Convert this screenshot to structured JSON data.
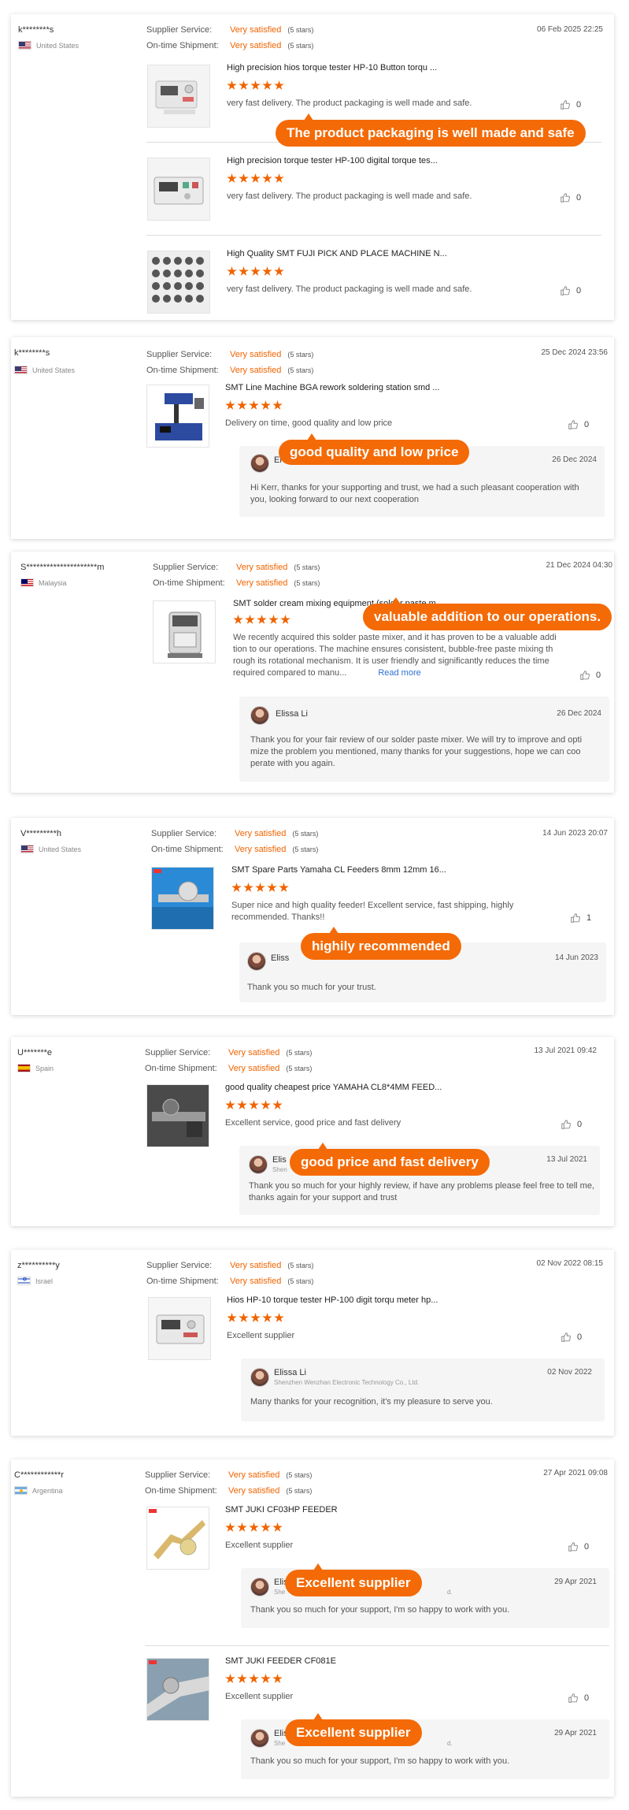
{
  "labels": {
    "supplier_service": "Supplier Service:",
    "ontime_shipment": "On-time Shipment:",
    "satisfied": "Very satisfied",
    "five_stars": "(5 stars)"
  },
  "colors": {
    "accent": "#f06400",
    "callout": "#f46a06",
    "link": "#2f6fd6"
  },
  "reviews": [
    {
      "buyer": "k********s",
      "country": "United States",
      "date": "06 Feb 2025 22:25",
      "products": [
        {
          "title": "High precision hios torque tester HP-10 Button torqu ...",
          "rating": 5,
          "text": "very fast delivery. The product packaging is well made and safe.",
          "likes": "0"
        },
        {
          "title": "High precision torque tester HP-100 digital torque tes...",
          "rating": 5,
          "text": "very fast delivery. The product packaging is well made and safe.",
          "likes": "0"
        },
        {
          "title": "High Quality SMT FUJI PICK AND PLACE MACHINE N...",
          "rating": 5,
          "text": "very fast delivery. The product packaging is well made and safe.",
          "likes": "0"
        }
      ],
      "callout": "The product packaging is well made and safe"
    },
    {
      "buyer": "k********s",
      "country": "United States",
      "date": "25 Dec 2024 23:56",
      "products": [
        {
          "title": "SMT Line Machine BGA rework soldering station smd ...",
          "rating": 5,
          "text": "Delivery on time, good quality and low price",
          "likes": "0"
        }
      ],
      "reply": {
        "name": "El",
        "date": "26 Dec 2024",
        "text": "Hi Kerr, thanks for your supporting and trust, we had a such pleasant cooperation with you, looking forward to our next cooperation"
      },
      "callout": "good quality and low price"
    },
    {
      "buyer": "S*********************m",
      "country": "Malaysia",
      "date": "21 Dec 2024 04:30",
      "products": [
        {
          "title": "SMT solder cream mixing equipment (solder paste m...",
          "rating": 5,
          "text": "We recently acquired this solder paste mixer, and it has proven to be a valuable addi tion to our operations. The machine ensures consistent, bubble-free paste mixing th rough its rotational mechanism. It is user friendly and significantly reduces the time required compared to manu...",
          "read_more": "Read more",
          "likes": "0"
        }
      ],
      "reply": {
        "name": "Elissa Li",
        "date": "26 Dec 2024",
        "text": "Thank you for your fair review of our solder paste mixer. We will try to improve and opti mize the problem you mentioned, many thanks for your suggestions, hope we can coo perate with you again."
      },
      "callout": "valuable addition to our operations."
    },
    {
      "buyer": "V*********h",
      "country": "United States",
      "date": "14 Jun 2023 20:07",
      "products": [
        {
          "title": "SMT Spare Parts Yamaha CL Feeders 8mm 12mm 16...",
          "rating": 5,
          "text": "Super nice and high quality feeder! Excellent service, fast shipping, highly recommended. Thanks!!",
          "likes": "1"
        }
      ],
      "reply": {
        "name": "Eliss",
        "date": "14 Jun 2023",
        "text": "Thank you so much for your trust."
      },
      "callout": "highily recommended"
    },
    {
      "buyer": "U*******e",
      "country": "Spain",
      "date": "13 Jul 2021 09:42",
      "products": [
        {
          "title": "good quality cheapest price YAMAHA CL8*4MM FEED...",
          "rating": 5,
          "text": "Excellent service, good price and fast delivery",
          "likes": "0"
        }
      ],
      "reply": {
        "name": "Elis",
        "company": "Shen",
        "date": "13 Jul 2021",
        "text": "Thank you so much for your highly review,  if have any problems please feel free to tell me, thanks again for your support and trust"
      },
      "callout": "good price and fast delivery"
    },
    {
      "buyer": "z**********y",
      "country": "Israel",
      "date": "02 Nov 2022 08:15",
      "products": [
        {
          "title": "Hios HP-10 torque tester HP-100 digit torqu meter hp...",
          "rating": 5,
          "text": "Excellent supplier",
          "likes": "0"
        }
      ],
      "reply": {
        "name": "Elissa Li",
        "company": "Shenzhen Wenzhan Electronic Technology Co., Ltd.",
        "date": "02 Nov 2022",
        "text": "Many thanks for your recognition, it's my pleasure to serve you."
      }
    },
    {
      "buyer": "C************r",
      "country": "Argentina",
      "date": "27 Apr 2021 09:08",
      "products": [
        {
          "title": "SMT JUKI CF03HP FEEDER",
          "rating": 5,
          "text": "Excellent supplier",
          "likes": "0",
          "reply": {
            "name": "Elis",
            "company": "She",
            "company_tail": "d.",
            "date": "29 Apr 2021",
            "text": "Thank you so much for your support, I'm so happy to work with you."
          },
          "callout": "Excellent supplier"
        },
        {
          "title": "SMT JUKI FEEDER CF081E",
          "rating": 5,
          "text": "Excellent supplier",
          "likes": "0",
          "reply": {
            "name": "Elis",
            "company": "She",
            "company_tail": "d.",
            "date": "29 Apr 2021",
            "text": "Thank you so much for your support, I'm so happy to work with you."
          },
          "callout": "Excellent supplier"
        }
      ]
    }
  ]
}
